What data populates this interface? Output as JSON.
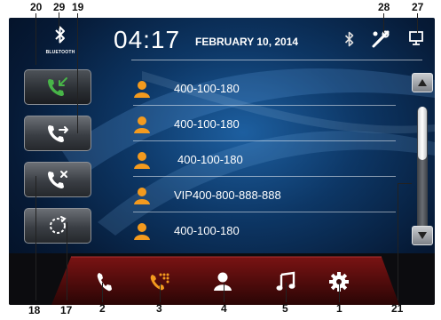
{
  "callouts": {
    "c20": "20",
    "c29": "29",
    "c19": "19",
    "c28": "28",
    "c27": "27",
    "c18": "18",
    "c17": "17",
    "c2": "2",
    "c3": "3",
    "c4": "4",
    "c5": "5",
    "c1": "1",
    "c21": "21"
  },
  "status": {
    "bluetooth_label": "BLUETOOTH",
    "time": "04:17",
    "date": "FEBRUARY 10, 2014"
  },
  "call_log": [
    {
      "number": "400-100-180"
    },
    {
      "number": "400-100-180"
    },
    {
      "number": "400-100-180"
    },
    {
      "number": "VIP400-800-888-888"
    },
    {
      "number": "400-100-180"
    }
  ],
  "colors": {
    "accent_orange": "#f39a1e",
    "call_green": "#48b548",
    "screen_dark": "#061a36"
  },
  "icons": {
    "left_buttons": [
      "received-calls-icon",
      "dialed-calls-icon",
      "missed-calls-icon",
      "sync-icon"
    ],
    "dock": [
      "phone-icon",
      "dialpad-icon",
      "contacts-icon",
      "music-icon",
      "settings-icon"
    ]
  }
}
